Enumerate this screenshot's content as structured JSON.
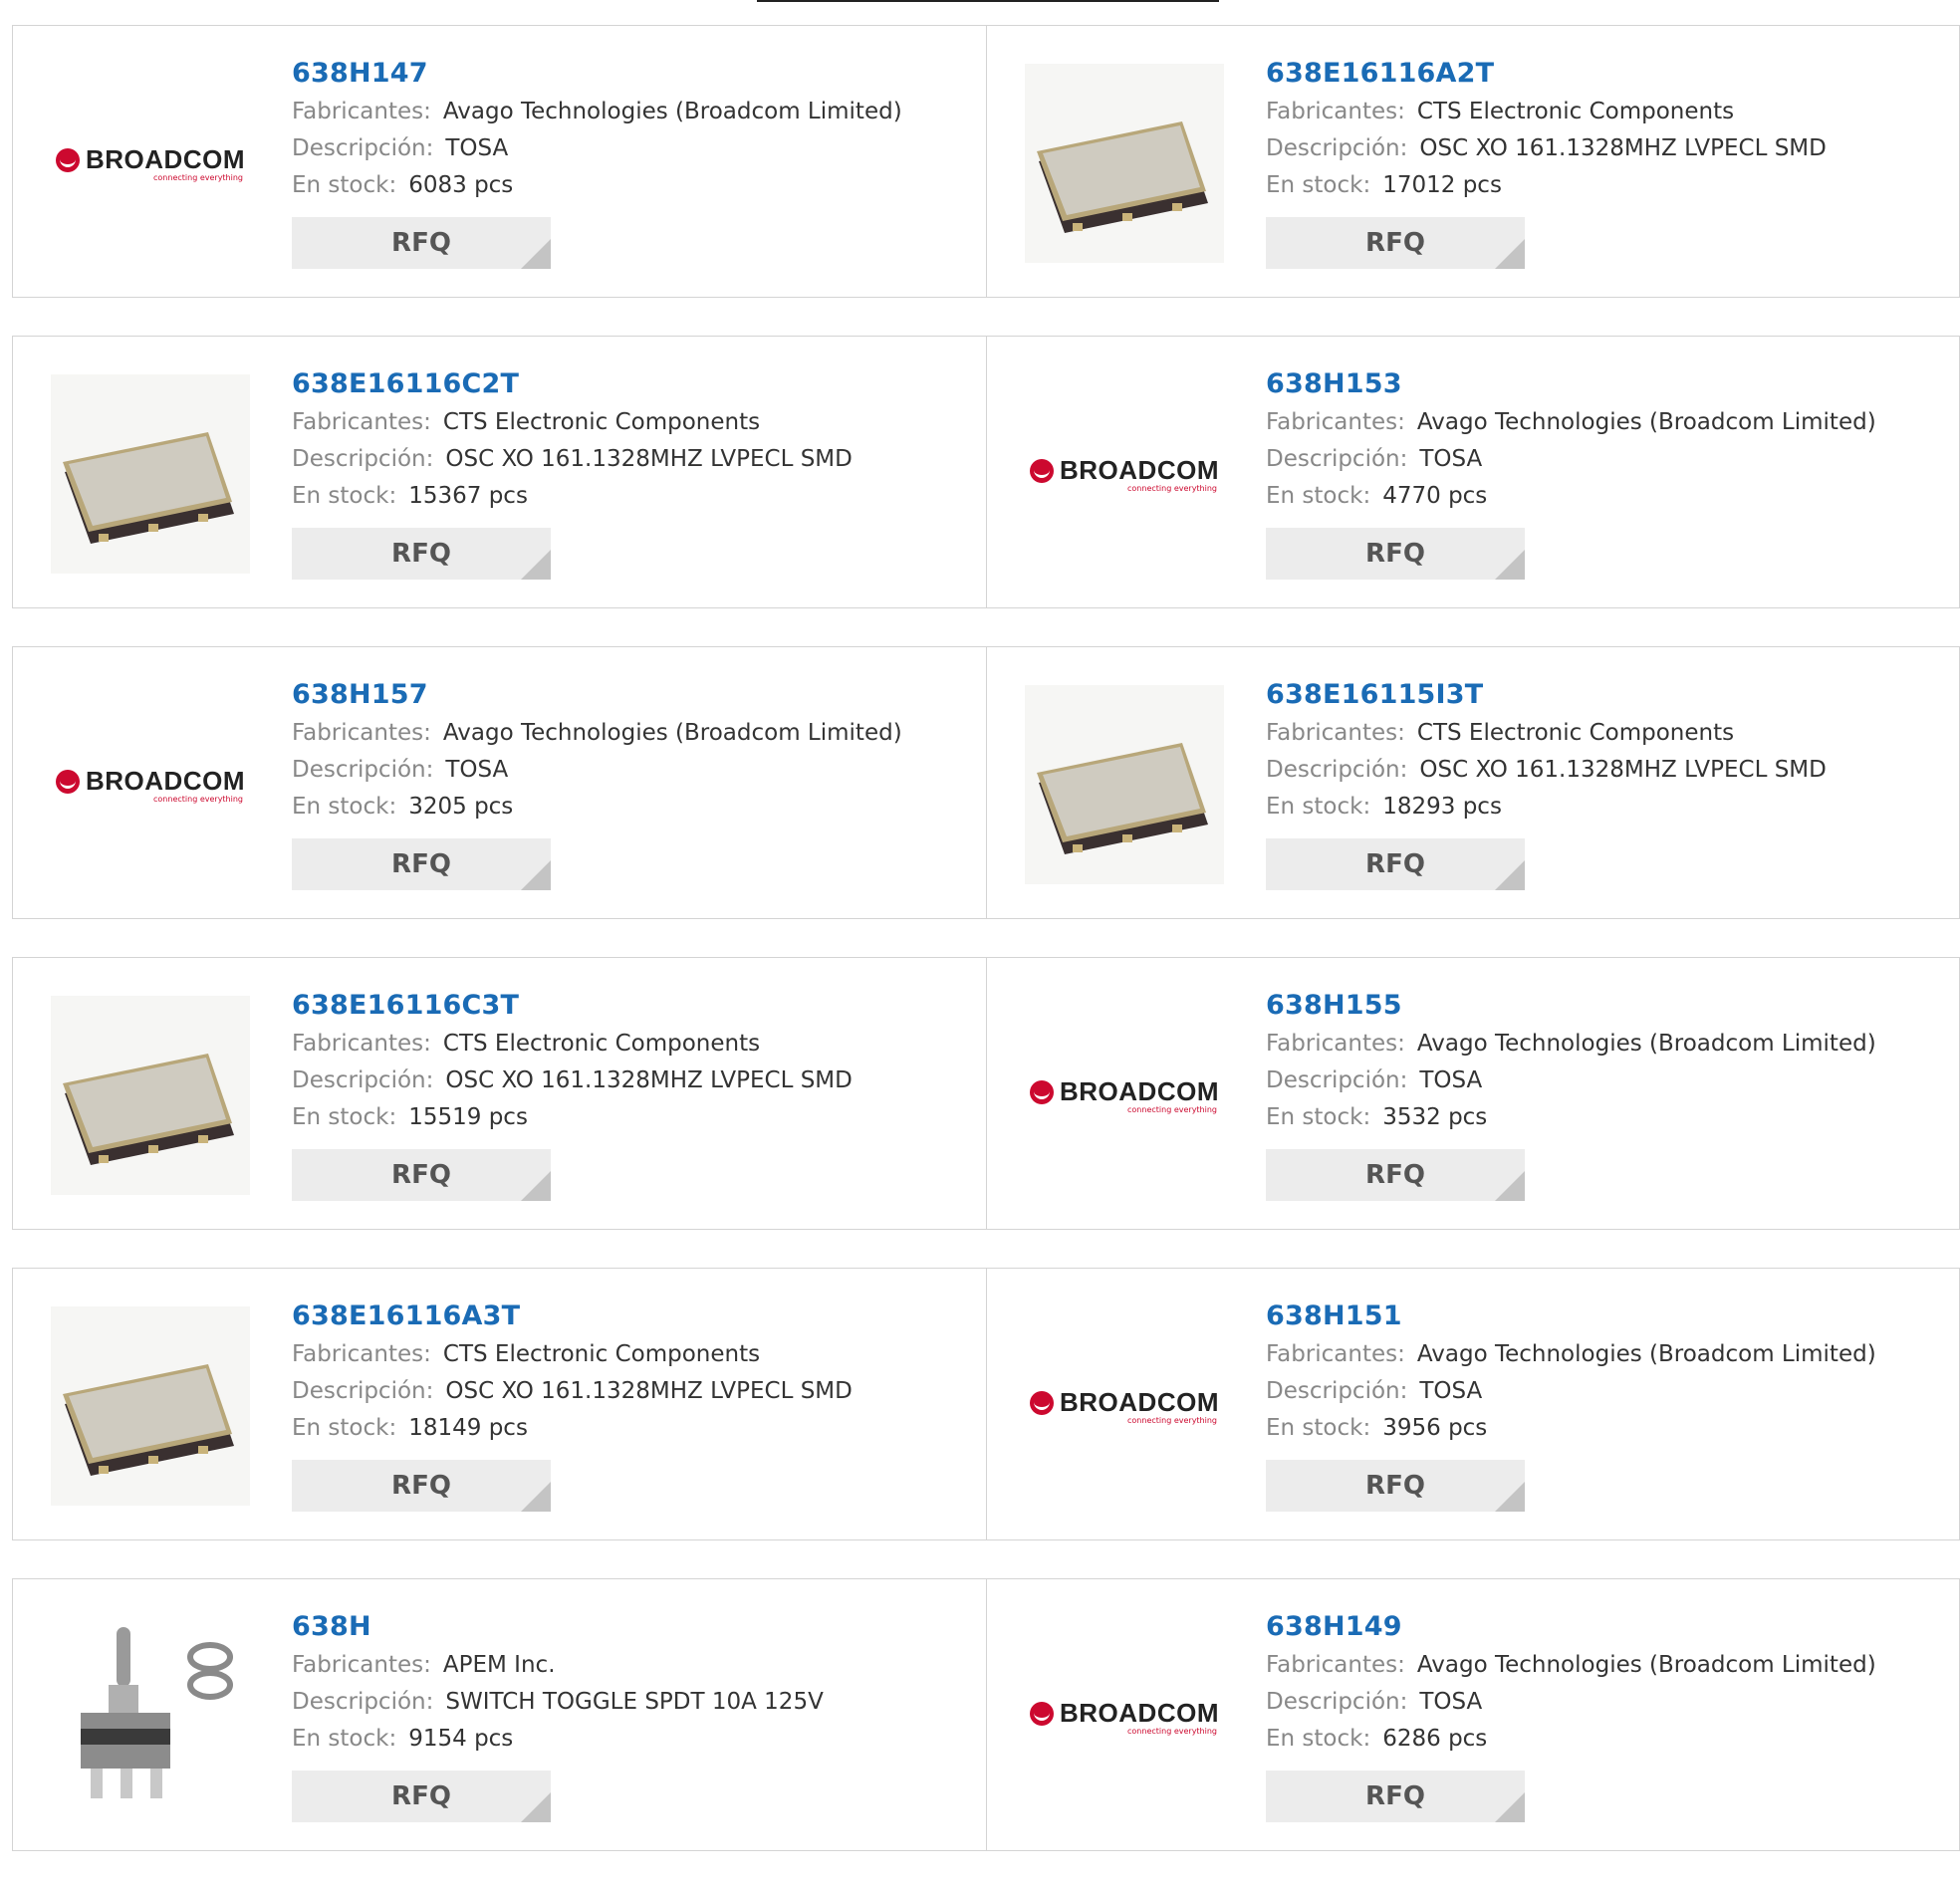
{
  "labels": {
    "manufacturer": "Fabricantes:",
    "description": "Descripción:",
    "stock": "En stock:",
    "rfq": "RFQ"
  },
  "products": [
    {
      "part": "638H147",
      "manufacturer": "Avago Technologies (Broadcom Limited)",
      "description": "TOSA",
      "stock": "6083 pcs",
      "image": "broadcom-logo"
    },
    {
      "part": "638E16116A2T",
      "manufacturer": "CTS Electronic Components",
      "description": "OSC XO 161.1328MHZ LVPECL SMD",
      "stock": "17012 pcs",
      "image": "oscillator-chip"
    },
    {
      "part": "638E16116C2T",
      "manufacturer": "CTS Electronic Components",
      "description": "OSC XO 161.1328MHZ LVPECL SMD",
      "stock": "15367 pcs",
      "image": "oscillator-chip"
    },
    {
      "part": "638H153",
      "manufacturer": "Avago Technologies (Broadcom Limited)",
      "description": "TOSA",
      "stock": "4770 pcs",
      "image": "broadcom-logo"
    },
    {
      "part": "638H157",
      "manufacturer": "Avago Technologies (Broadcom Limited)",
      "description": "TOSA",
      "stock": "3205 pcs",
      "image": "broadcom-logo"
    },
    {
      "part": "638E16115I3T",
      "manufacturer": "CTS Electronic Components",
      "description": "OSC XO 161.1328MHZ LVPECL SMD",
      "stock": "18293 pcs",
      "image": "oscillator-chip"
    },
    {
      "part": "638E16116C3T",
      "manufacturer": "CTS Electronic Components",
      "description": "OSC XO 161.1328MHZ LVPECL SMD",
      "stock": "15519 pcs",
      "image": "oscillator-chip"
    },
    {
      "part": "638H155",
      "manufacturer": "Avago Technologies (Broadcom Limited)",
      "description": "TOSA",
      "stock": "3532 pcs",
      "image": "broadcom-logo"
    },
    {
      "part": "638E16116A3T",
      "manufacturer": "CTS Electronic Components",
      "description": "OSC XO 161.1328MHZ LVPECL SMD",
      "stock": "18149 pcs",
      "image": "oscillator-chip"
    },
    {
      "part": "638H151",
      "manufacturer": "Avago Technologies (Broadcom Limited)",
      "description": "TOSA",
      "stock": "3956 pcs",
      "image": "broadcom-logo"
    },
    {
      "part": "638H",
      "manufacturer": "APEM Inc.",
      "description": "SWITCH TOGGLE SPDT 10A 125V",
      "stock": "9154 pcs",
      "image": "toggle-switch"
    },
    {
      "part": "638H149",
      "manufacturer": "Avago Technologies (Broadcom Limited)",
      "description": "TOSA",
      "stock": "6286 pcs",
      "image": "broadcom-logo"
    }
  ],
  "broadcom": {
    "name": "BROADCOM",
    "tagline": "connecting everything"
  },
  "colors": {
    "link": "#1a6bb5",
    "label": "#888888",
    "button_bg": "#ececec",
    "brand_red": "#cc092f"
  }
}
